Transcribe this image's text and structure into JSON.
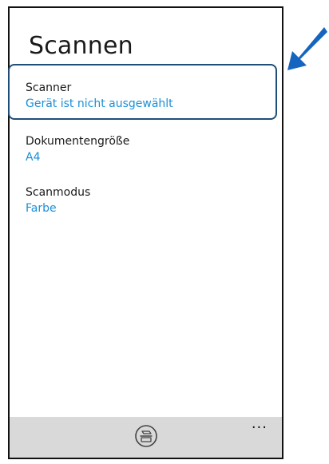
{
  "page": {
    "title": "Scannen"
  },
  "settings": [
    {
      "label": "Scanner",
      "value": "Gerät ist nicht ausgewählt"
    },
    {
      "label": "Dokumentengröße",
      "value": "A4"
    },
    {
      "label": "Scanmodus",
      "value": "Farbe"
    }
  ],
  "app_bar": {
    "scan_icon": "scan-icon",
    "more_glyph": "..."
  },
  "colors": {
    "accent": "#1a8fd6",
    "highlight_border": "#1f4e79",
    "pointer_arrow": "#1565c0",
    "app_bar_bg": "#d9d9d9"
  }
}
